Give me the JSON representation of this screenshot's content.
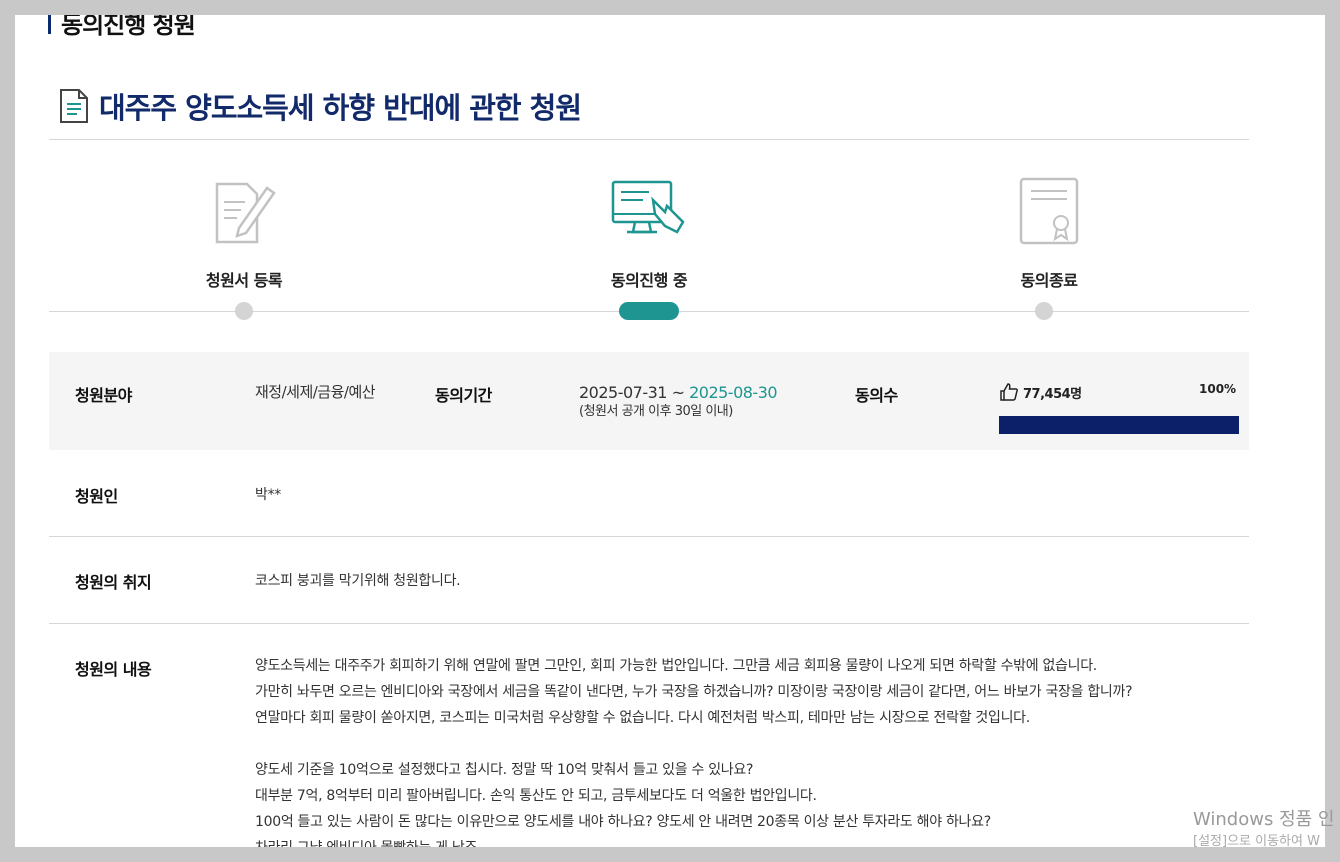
{
  "section": {
    "title": "동의진행 청원"
  },
  "petition": {
    "title": "대주주 양도소득세 하향 반대에 관한 청원"
  },
  "steps": [
    {
      "label": "청원서 등록",
      "state": "done"
    },
    {
      "label": "동의진행 중",
      "state": "active"
    },
    {
      "label": "동의종료",
      "state": "pending"
    }
  ],
  "info": {
    "field_label": "청원분야",
    "field_value": "재정/세제/금융/예산",
    "period_label": "동의기간",
    "period_start": "2025-07-31",
    "period_sep": "~",
    "period_end": "2025-08-30",
    "period_note": "(청원서 공개 이후 30일 이내)",
    "count_label": "동의수",
    "count_value": "77,454명",
    "percent": "100%",
    "progress_fraction": 1.0
  },
  "rows": {
    "petitioner_label": "청원인",
    "petitioner_value": "박**",
    "purpose_label": "청원의 취지",
    "purpose_value": "코스피 붕괴를 막기위해 청원합니다.",
    "content_label": "청원의 내용"
  },
  "content_lines": [
    "양도소득세는 대주주가 회피하기 위해 연말에 팔면 그만인, 회피 가능한 법안입니다. 그만큼 세금 회피용 물량이 나오게 되면 하락할 수밖에 없습니다.",
    "가만히 놔두면 오르는 엔비디아와 국장에서 세금을 똑같이 낸다면, 누가 국장을 하겠습니까? 미장이랑 국장이랑 세금이 같다면, 어느 바보가 국장을 합니까?",
    "연말마다 회피 물량이 쏟아지면, 코스피는 미국처럼 우상향할 수 없습니다. 다시 예전처럼 박스피, 테마만 남는 시장으로 전락할 것입니다.",
    "",
    "양도세 기준을 10억으로 설정했다고 칩시다. 정말 딱 10억 맞춰서 들고 있을 수 있나요?",
    "대부분 7억, 8억부터 미리 팔아버립니다. 손익 통산도 안 되고, 금투세보다도 더 억울한 법안입니다.",
    "100억 들고 있는 사람이 돈 많다는 이유만으로 양도세를 내야 하나요? 양도세 안 내려면 20종목 이상 분산 투자라도 해야 하나요?",
    "차라리 그냥 엔비디아 몰빵하는 게 낫죠."
  ],
  "watermark": {
    "line1": "Windows 정품 인",
    "line2": "[설정]으로 이동하여 W"
  },
  "colors": {
    "navy": "#0b2068",
    "teal": "#1e9590",
    "title_navy": "#12296a"
  }
}
